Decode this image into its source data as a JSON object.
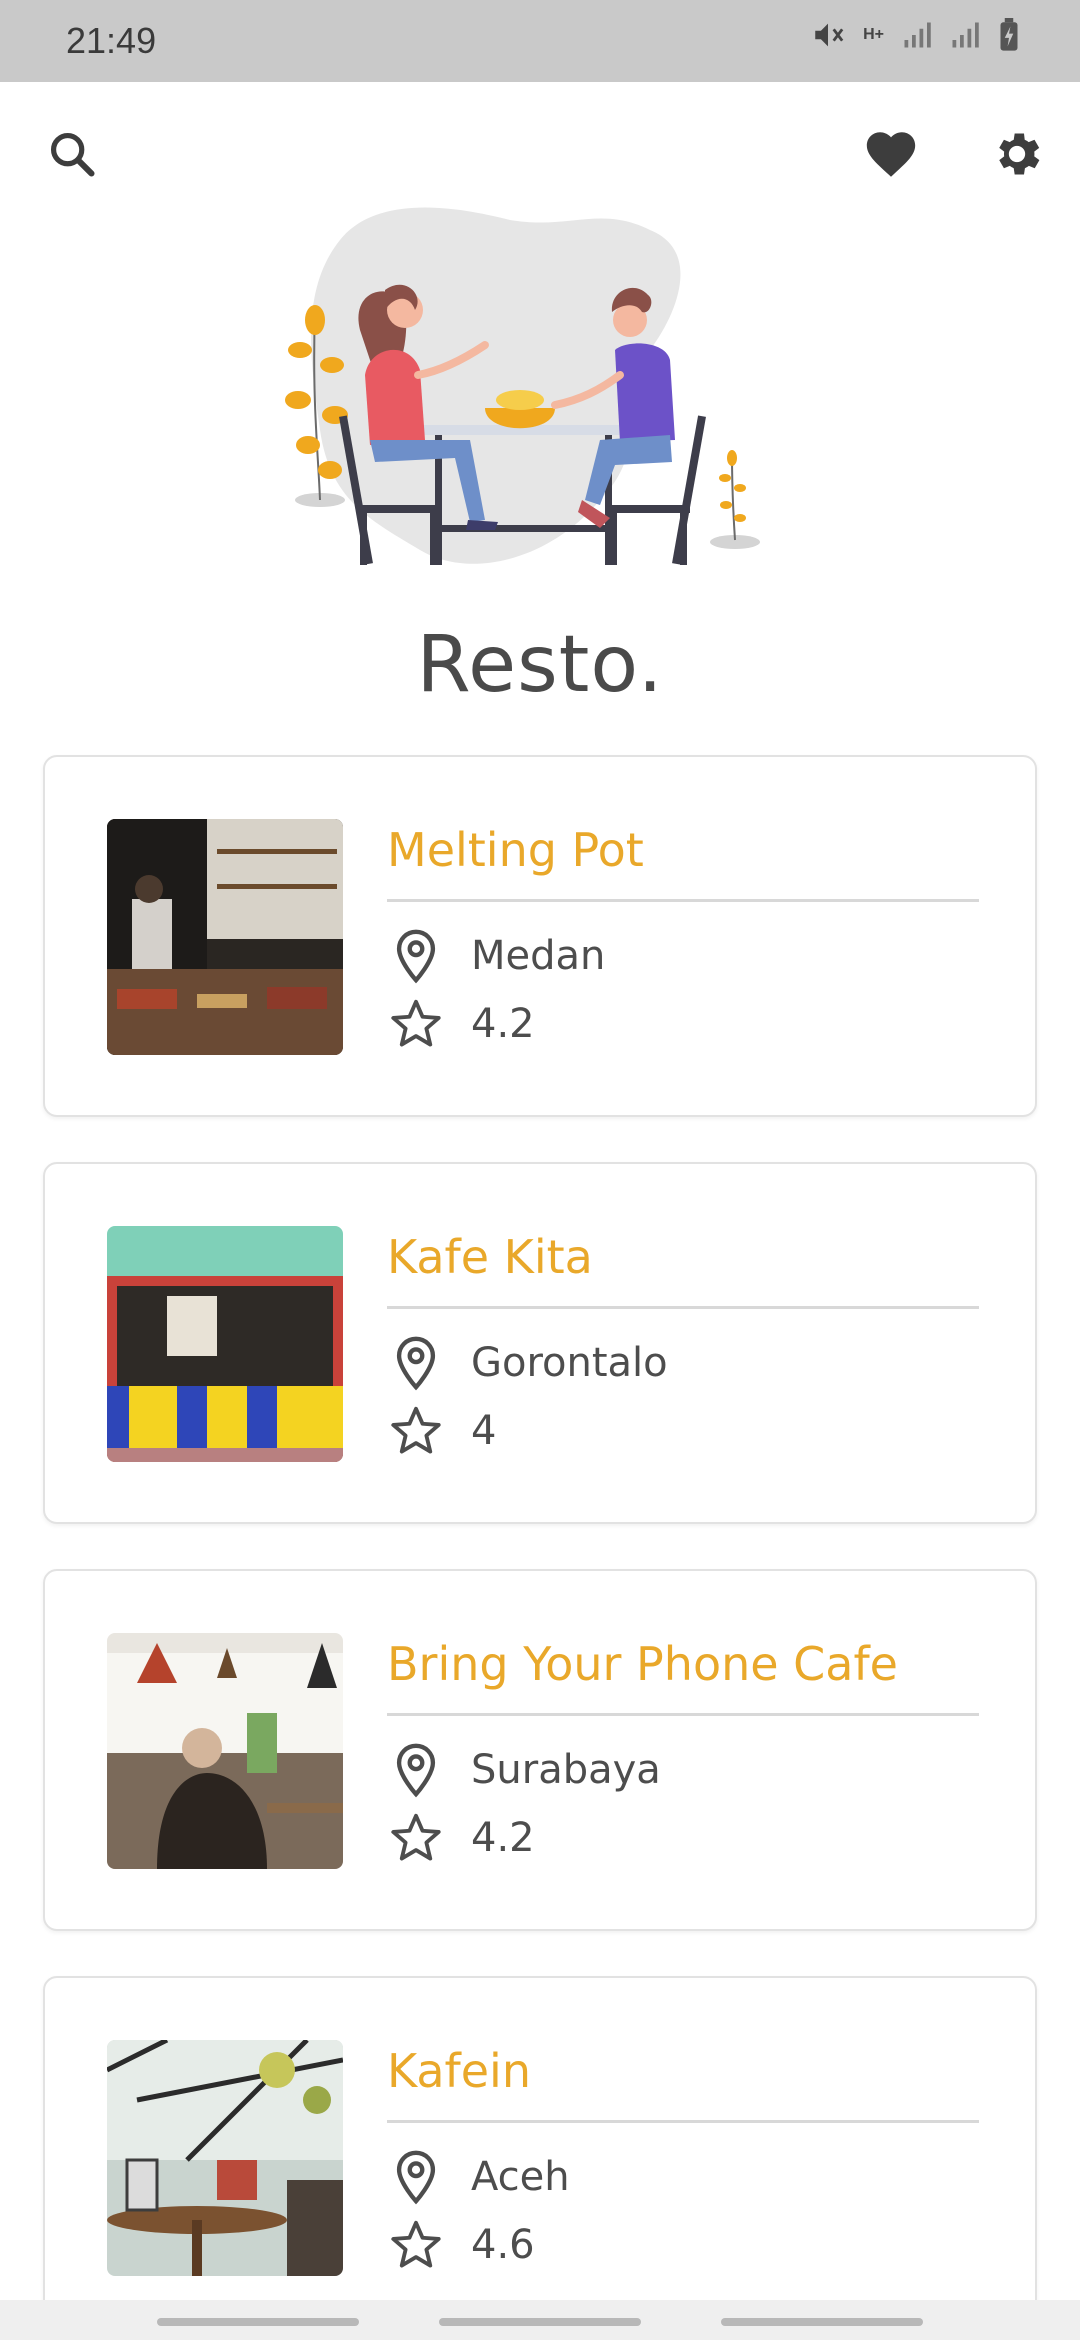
{
  "status_bar": {
    "time": "21:49",
    "network_label": "H+",
    "icons": [
      "mute-icon",
      "network-h-plus-icon",
      "signal-icon",
      "signal-icon",
      "battery-charging-icon"
    ]
  },
  "toolbar": {
    "left_icon": "search-icon",
    "right_icons": [
      "favorite-heart-icon",
      "settings-gear-icon"
    ]
  },
  "hero": {
    "illustration": "couple-dining-illustration"
  },
  "app": {
    "title": "Resto."
  },
  "colors": {
    "accent": "#e9a82a",
    "text": "#4d4d4d",
    "status_bar": "#c9c9c9"
  },
  "restaurants": [
    {
      "name": "Melting Pot",
      "city": "Medan",
      "rating": "4.2"
    },
    {
      "name": "Kafe Kita",
      "city": "Gorontalo",
      "rating": "4"
    },
    {
      "name": "Bring Your Phone Cafe",
      "city": "Surabaya",
      "rating": "4.2"
    },
    {
      "name": "Kafein",
      "city": "Aceh",
      "rating": "4.6"
    }
  ]
}
